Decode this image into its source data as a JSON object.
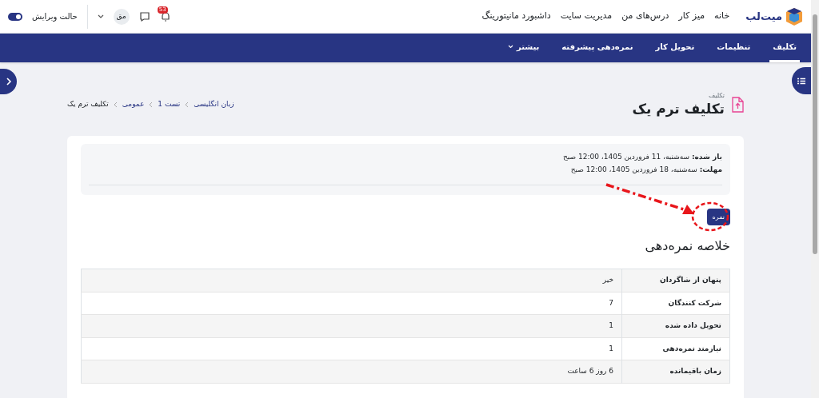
{
  "brand": "میت‌لب",
  "top_nav": [
    "خانه",
    "میز کار",
    "درس‌های من",
    "مدیریت سایت",
    "داشبورد مانیتورینگ"
  ],
  "notifications": {
    "count": "53"
  },
  "user": {
    "initials": "مق"
  },
  "edit_mode": {
    "label": "حالت ویرایش",
    "on": true
  },
  "tabs": [
    {
      "label": "تکلیف",
      "selected": true,
      "kind": "tab"
    },
    {
      "label": "تنظیمات",
      "selected": false,
      "kind": "tab"
    },
    {
      "label": "تحویل کار",
      "selected": false,
      "kind": "tab"
    },
    {
      "label": "نمره‌دهی پیشرفته",
      "selected": false,
      "kind": "tab"
    },
    {
      "label": "بیشتر",
      "selected": false,
      "kind": "menu"
    }
  ],
  "page": {
    "module": "تکلیف",
    "title": "تکلیف ترم یک"
  },
  "breadcrumb": [
    "زبان انگلیسی",
    "تست 1",
    "عمومی",
    "تکلیف ترم یک"
  ],
  "dates": [
    {
      "label": "باز شده:",
      "value": "سه‌شنبه، 11 فروردین 1405، 12:00 صبح"
    },
    {
      "label": "مهلت:",
      "value": "سه‌شنبه، 18 فروردین 1405، 12:00 صبح"
    }
  ],
  "grade_button": "نمره",
  "summary": {
    "title": "خلاصه نمره‌دهی",
    "rows": [
      {
        "label": "پنهان از شاگردان",
        "value": "خیر"
      },
      {
        "label": "شرکت کنندگان",
        "value": "7"
      },
      {
        "label": "تحویل داده شده",
        "value": "1"
      },
      {
        "label": "نیازمند نمره‌دهی",
        "value": "1"
      },
      {
        "label": "زمان باقیمانده",
        "value": "6 روز 6 ساعت"
      }
    ]
  }
}
